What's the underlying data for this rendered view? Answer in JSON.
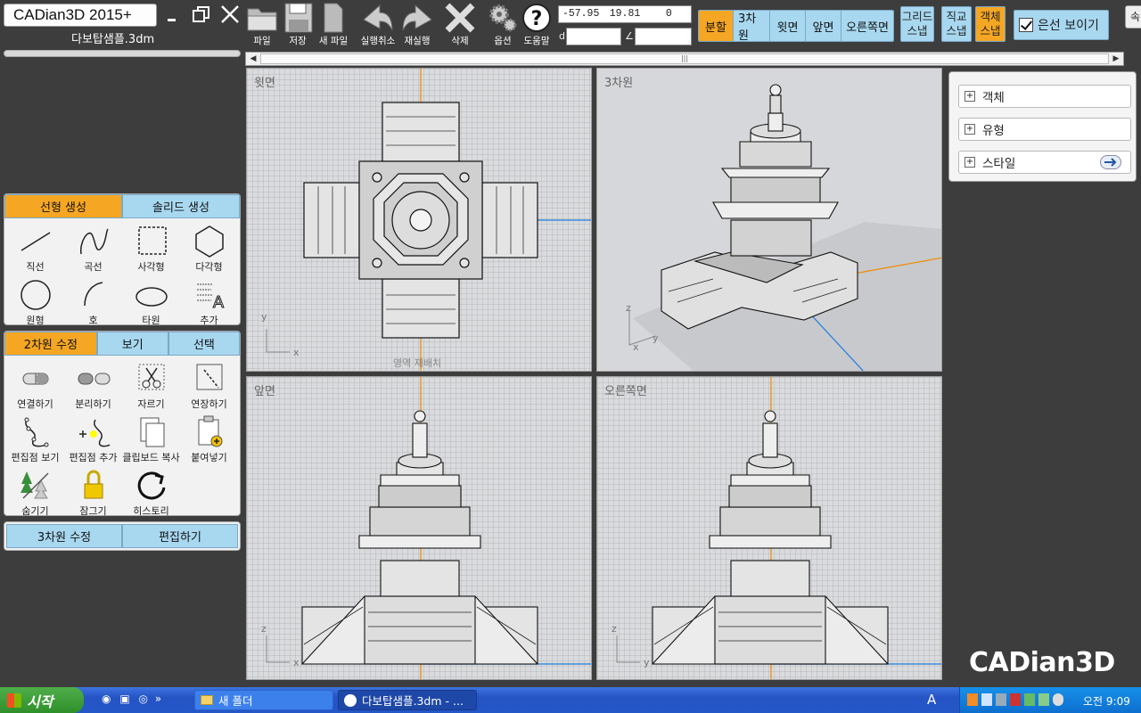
{
  "app": {
    "title": "CADian3D 2015+",
    "file_name": "다보탑샘플.3dm",
    "brand": "CADian3D"
  },
  "toolbar": {
    "tools": [
      {
        "icon": "folder-icon",
        "label": "파일"
      },
      {
        "icon": "save-icon",
        "label": "저장"
      },
      {
        "icon": "new-file-icon",
        "label": "새 파일"
      },
      {
        "icon": "undo-icon",
        "label": "실행취소"
      },
      {
        "icon": "redo-icon",
        "label": "재실행"
      },
      {
        "icon": "delete-icon",
        "label": "삭제"
      },
      {
        "icon": "gear-icon",
        "label": "옵션"
      },
      {
        "icon": "help-icon",
        "label": "도움말"
      }
    ],
    "coords": {
      "x": "-57.95",
      "y": "19.81",
      "z": "0"
    },
    "distance_label": "d",
    "angle_label": "∠",
    "views": [
      "분할",
      "3차원",
      "윗면",
      "앞면",
      "오른쪽면"
    ],
    "active_view": "분할",
    "snaps": [
      {
        "line1": "그리드",
        "line2": "스냅",
        "active": false
      },
      {
        "line1": "직교",
        "line2": "스냅",
        "active": false
      },
      {
        "line1": "객체",
        "line2": "스냅",
        "active": true
      }
    ],
    "hidden_lines_label": "은선 보이기",
    "far_right_label": "속"
  },
  "left_panel": {
    "create_tabs": [
      "선형 생성",
      "솔리드 생성"
    ],
    "create_items": [
      {
        "icon": "line-icon",
        "label": "직선"
      },
      {
        "icon": "curve-icon",
        "label": "곡선"
      },
      {
        "icon": "rectangle-icon",
        "label": "사각형"
      },
      {
        "icon": "polygon-icon",
        "label": "다각형"
      },
      {
        "icon": "circle-icon",
        "label": "원형"
      },
      {
        "icon": "arc-icon",
        "label": "호"
      },
      {
        "icon": "ellipse-icon",
        "label": "타원"
      },
      {
        "icon": "text-icon",
        "label": "추가"
      }
    ],
    "edit_tabs": [
      "2차원 수정",
      "보기",
      "선택"
    ],
    "edit_items": [
      {
        "icon": "join-icon",
        "label": "연결하기"
      },
      {
        "icon": "split-icon",
        "label": "분리하기"
      },
      {
        "icon": "scissors-icon",
        "label": "자르기"
      },
      {
        "icon": "extend-icon",
        "label": "연장하기"
      },
      {
        "icon": "edit-points-icon",
        "label": "편집점 보기"
      },
      {
        "icon": "add-point-icon",
        "label": "편집점 추가"
      },
      {
        "icon": "clipboard-copy-icon",
        "label": "클립보드 복사"
      },
      {
        "icon": "paste-icon",
        "label": "붙여넣기"
      },
      {
        "icon": "hide-icon",
        "label": "숨기기"
      },
      {
        "icon": "lock-icon",
        "label": "잠그기"
      },
      {
        "icon": "history-icon",
        "label": "히스토리"
      }
    ],
    "bottom_tabs": [
      "3차원 수정",
      "편집하기"
    ]
  },
  "viewports": [
    {
      "title": "윗면",
      "axis_v": "y",
      "axis_h": "x",
      "overlay": "영역 재배치"
    },
    {
      "title": "3차원",
      "axis_v": "z",
      "axis_h": "y",
      "axis_d": "x"
    },
    {
      "title": "앞면",
      "axis_v": "z",
      "axis_h": "x"
    },
    {
      "title": "오른쪽면",
      "axis_v": "z",
      "axis_h": "y"
    }
  ],
  "right_panel": {
    "items": [
      "객체",
      "유형",
      "스타일"
    ]
  },
  "taskbar": {
    "start_label": "시작",
    "tasks": [
      "새 폴더",
      "다보탑샘플.3dm - ..."
    ],
    "lang": "A",
    "clock": "오전 9:09"
  }
}
